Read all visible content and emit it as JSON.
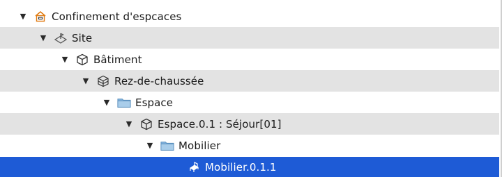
{
  "tree": {
    "nodes": [
      {
        "label": "Confinement d'espcaces",
        "icon": "building-icon",
        "expanded": true,
        "depth": 0
      },
      {
        "label": "Site",
        "icon": "site-icon",
        "expanded": true,
        "depth": 1
      },
      {
        "label": "Bâtiment",
        "icon": "cube-icon",
        "expanded": true,
        "depth": 2
      },
      {
        "label": "Rez-de-chaussée",
        "icon": "storey-icon",
        "expanded": true,
        "depth": 3
      },
      {
        "label": "Espace",
        "icon": "folder-icon",
        "expanded": true,
        "depth": 4
      },
      {
        "label": "Espace.0.1 : Séjour[01]",
        "icon": "cube-icon",
        "expanded": true,
        "depth": 5
      },
      {
        "label": "Mobilier",
        "icon": "folder-icon",
        "expanded": true,
        "depth": 6
      },
      {
        "label": "Mobilier.0.1.1",
        "icon": "furniture-icon",
        "expanded": false,
        "depth": 7,
        "selected": true
      }
    ],
    "expander_glyph": "▼",
    "colors": {
      "alt_row": "#e3e3e3",
      "selection": "#1e5bd6",
      "folder": "#7fb0dc",
      "building_accent": "#e07a10"
    }
  }
}
